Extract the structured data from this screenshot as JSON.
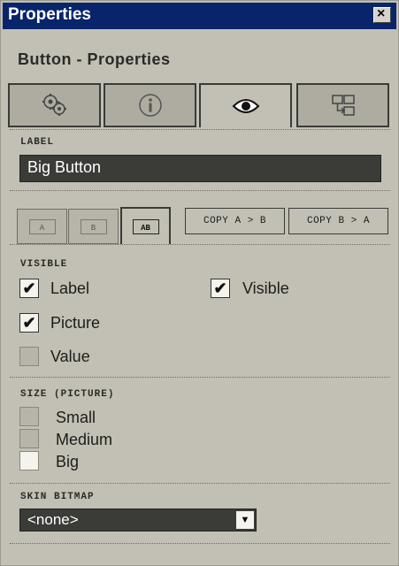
{
  "window": {
    "title": "Properties",
    "close_glyph": "×"
  },
  "panel": {
    "heading": "Button - Properties"
  },
  "tabs": [
    {
      "name": "tab-function",
      "icon": "gears-icon"
    },
    {
      "name": "tab-info",
      "icon": "info-icon"
    },
    {
      "name": "tab-view",
      "icon": "eye-icon",
      "active": true
    },
    {
      "name": "tab-connect",
      "icon": "connect-icon"
    }
  ],
  "label_section": {
    "title": "LABEL",
    "value": "Big Button"
  },
  "ab": {
    "tabs": [
      "A",
      "B",
      "AB"
    ],
    "copy_a_b": "COPY A > B",
    "copy_b_a": "COPY B > A"
  },
  "visible": {
    "title": "VISIBLE",
    "label": "Label",
    "visible": "Visible",
    "picture": "Picture",
    "value": "Value",
    "checked_glyph": "✔",
    "label_checked": true,
    "visible_checked": true,
    "picture_checked": true,
    "value_checked": false
  },
  "size": {
    "title": "SIZE (PICTURE)",
    "options": [
      "Small",
      "Medium",
      "Big"
    ],
    "selected": "Big"
  },
  "skin": {
    "title": "SKIN BITMAP",
    "value": "<none>",
    "arrow_glyph": "▼"
  },
  "colors": {
    "titlebar": "#08246b",
    "panel": "#c2c0b4",
    "field": "#3b3b38"
  }
}
